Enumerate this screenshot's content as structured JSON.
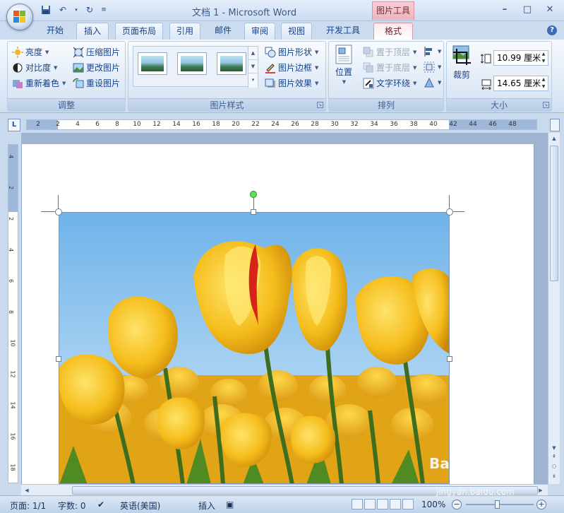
{
  "window": {
    "title": "文档 1 - Microsoft Word",
    "context_tab_title": "图片工具",
    "controls": [
      "–",
      "□",
      "✕"
    ]
  },
  "tabs": [
    "开始",
    "插入",
    "页面布局",
    "引用",
    "邮件",
    "审阅",
    "视图",
    "开发工具",
    "格式"
  ],
  "active_tab": "格式",
  "ribbon": {
    "adjust": {
      "label": "调整",
      "brightness": "亮度",
      "contrast": "对比度",
      "recolor": "重新着色",
      "compress": "压缩图片",
      "change": "更改图片",
      "reset": "重设图片"
    },
    "styles": {
      "label": "图片样式",
      "shape": "图片形状",
      "border": "图片边框",
      "effects": "图片效果"
    },
    "arrange": {
      "label": "排列",
      "position": "位置",
      "bring_front": "置于顶层",
      "send_back": "置于底层",
      "text_wrap": "文字环绕"
    },
    "size": {
      "label": "大小",
      "crop": "裁剪",
      "height": "10.99 厘米",
      "width": "14.65 厘米"
    }
  },
  "ruler": {
    "corner": "L",
    "h_ticks": [
      "2",
      "2",
      "4",
      "6",
      "8",
      "10",
      "12",
      "14",
      "16",
      "18",
      "20",
      "22",
      "24",
      "26",
      "28",
      "30",
      "32",
      "34",
      "36",
      "38",
      "40",
      "42",
      "44",
      "46",
      "48"
    ],
    "v_ticks": [
      "4",
      "2",
      "2",
      "4",
      "6",
      "8",
      "10",
      "12",
      "14",
      "16",
      "18"
    ]
  },
  "statusbar": {
    "page": "页面: 1/1",
    "words": "字数: 0",
    "language": "英语(美国)",
    "mode": "插入",
    "zoom": "100%"
  },
  "watermark": {
    "brand": "Bai 经验",
    "url": "jingyan.baidu.com"
  },
  "colors": {
    "accent": "#15428b",
    "context_tab": "#eeb4bf",
    "tulip": "#f2b71a",
    "sky": "#8cc2ec"
  }
}
